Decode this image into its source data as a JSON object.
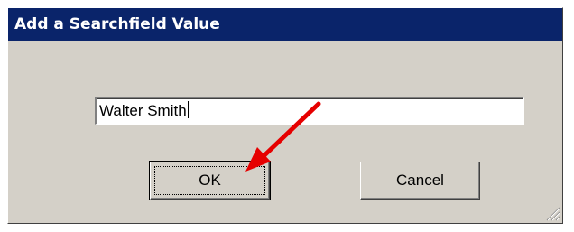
{
  "dialog": {
    "title": "Add a Searchfield Value"
  },
  "input": {
    "value": "Walter Smith"
  },
  "buttons": {
    "ok_label": "OK",
    "cancel_label": "Cancel"
  },
  "annotation": {
    "arrow_color": "#e60000"
  },
  "colors": {
    "titlebar": "#0a246a",
    "dialog_face": "#d4d0c8"
  }
}
